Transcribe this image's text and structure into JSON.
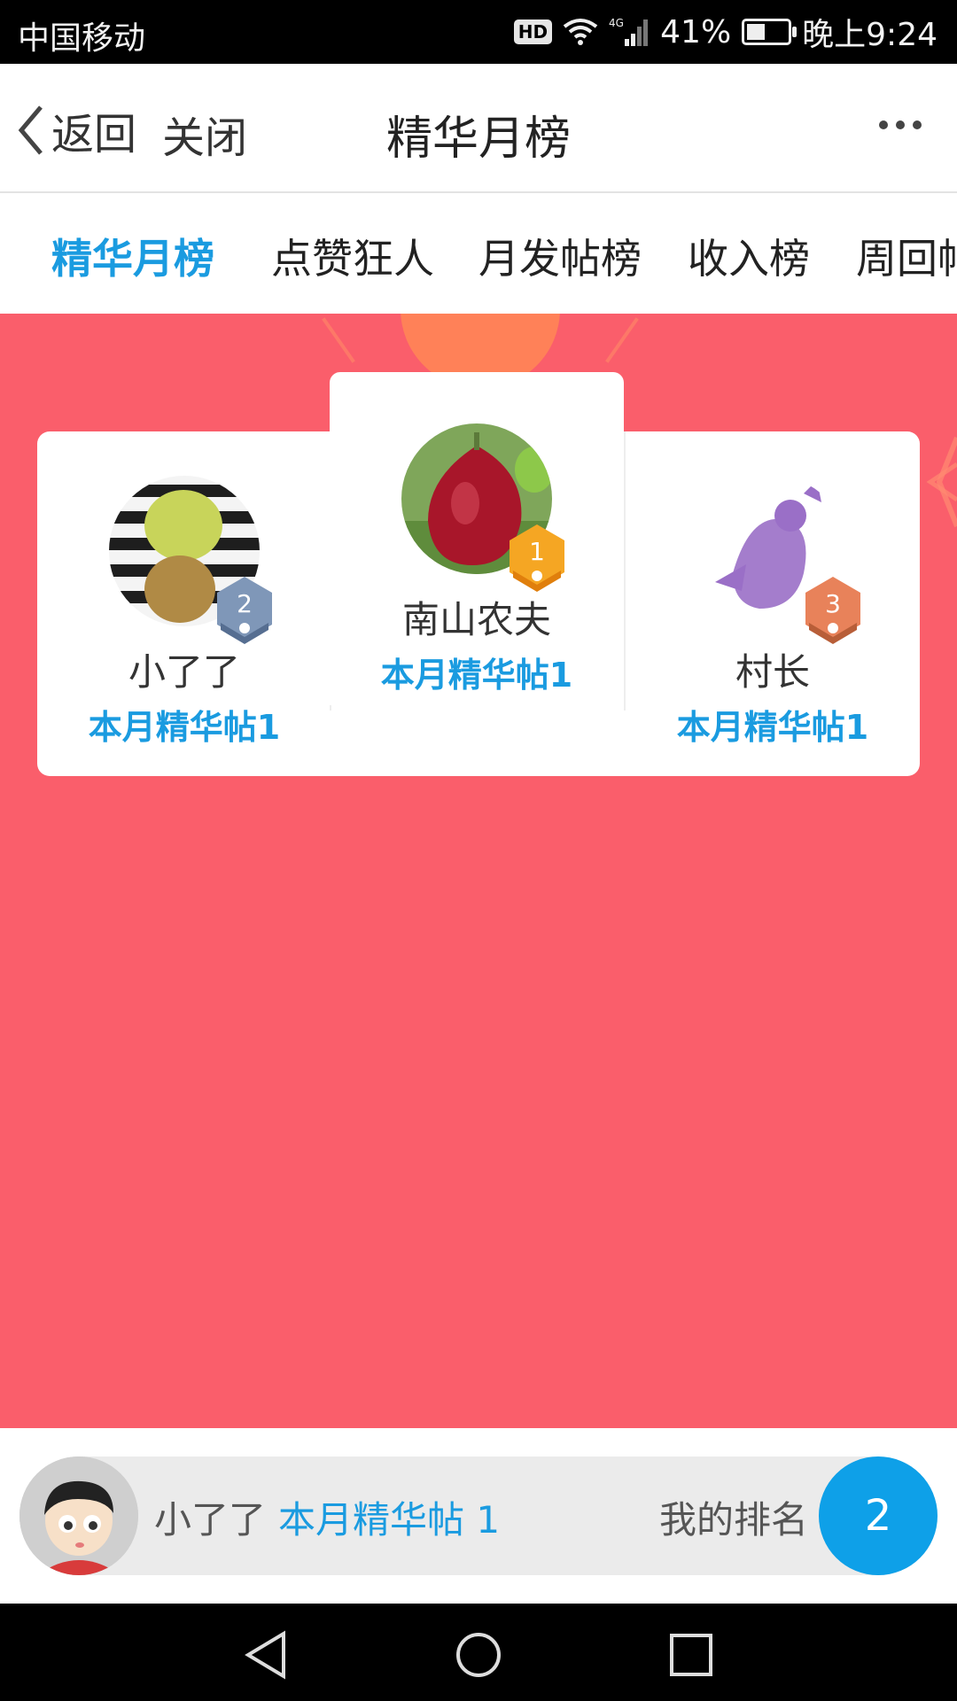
{
  "status_bar": {
    "carrier": "中国移动",
    "hd": "HD",
    "network": "4G",
    "battery": "41%",
    "time": "晚上9:24"
  },
  "header": {
    "back_label": "返回",
    "close_label": "关闭",
    "title": "精华月榜"
  },
  "tabs": [
    {
      "label": "精华月榜",
      "active": true
    },
    {
      "label": "点赞狂人",
      "active": false
    },
    {
      "label": "月发帖榜",
      "active": false
    },
    {
      "label": "收入榜",
      "active": false
    },
    {
      "label": "周回帖",
      "active": false
    }
  ],
  "podium": {
    "first": {
      "rank": "1",
      "name": "南山农夫",
      "stat": "本月精华帖1"
    },
    "second": {
      "rank": "2",
      "name": "小了了",
      "stat": "本月精华帖1"
    },
    "third": {
      "rank": "3",
      "name": "村长",
      "stat": "本月精华帖1"
    }
  },
  "my_rank": {
    "name": "小了了",
    "stat": "本月精华帖 1",
    "label": "我的排名",
    "rank": "2"
  },
  "colors": {
    "accent": "#1a9be0",
    "background": "#fa5e6b",
    "gold": "#f5a623",
    "silver": "#7f97b8",
    "bronze": "#e8825a"
  }
}
